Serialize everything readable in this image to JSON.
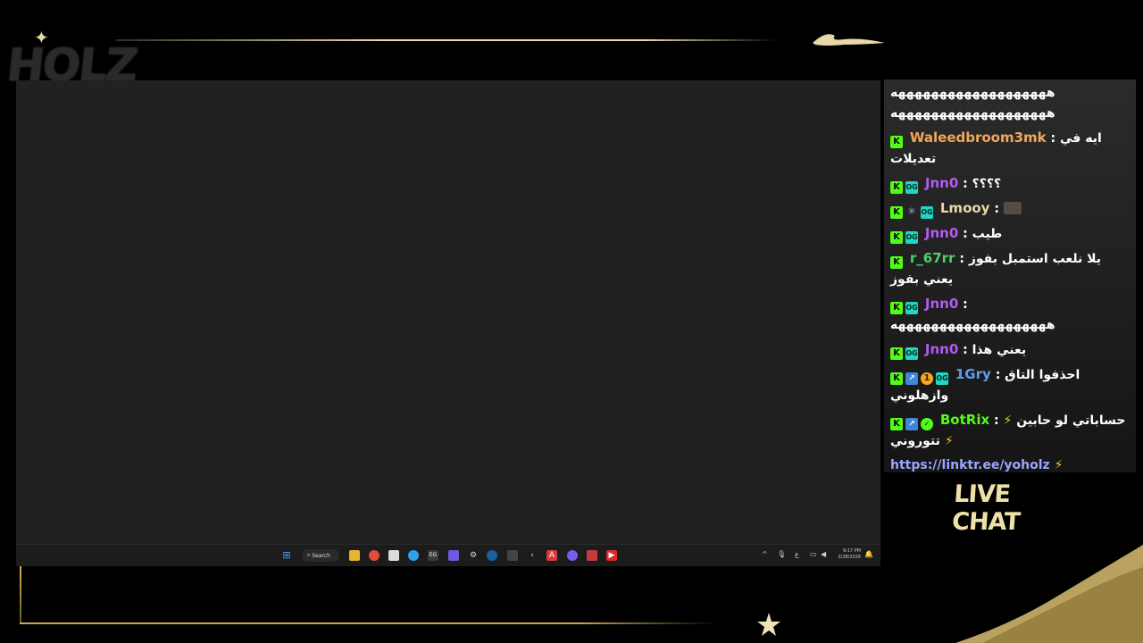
{
  "overlay": {
    "logo_text": "HOLZ",
    "chat_title": "LIVE CHAT"
  },
  "taskbar": {
    "search_label": "Search",
    "clock_time": "9:17 PM",
    "clock_date": "3/28/2026",
    "ime_indicator": "ع"
  },
  "chat": {
    "messages": [
      {
        "username": "",
        "text": "هههههههههههههههههههه\nهههههههههههههههههههه"
      },
      {
        "username": "Waleedbroom3mk",
        "username_color": "#f2a65a",
        "text": "ايه في تعديلات"
      },
      {
        "username": "Jnn0",
        "username_color": "#b05cf0",
        "text": "؟؟؟؟"
      },
      {
        "username": "Lmooy",
        "username_color": "#e9d8a6",
        "text": ""
      },
      {
        "username": "Jnn0",
        "username_color": "#b05cf0",
        "text": "طيب"
      },
      {
        "username": "r_67rr",
        "username_color": "#4fcf68",
        "text": "يلا نلعب استمبل بفوز يعني بفوز"
      },
      {
        "username": "Jnn0",
        "username_color": "#b05cf0",
        "text": "هههههههههههههههههههه"
      },
      {
        "username": "Jnn0",
        "username_color": "#b05cf0",
        "text": "يعني هذا"
      },
      {
        "username": "1Gry",
        "username_color": "#5aa0f0",
        "text": "احذفوا التاق وازهلوني"
      },
      {
        "username": "BotRix",
        "username_color": "#53fc18",
        "text": "حساباتي لو حابين تتوروني"
      },
      {
        "username": "",
        "text": "https://linktr.ee/yoholz"
      }
    ]
  },
  "colors": {
    "gold": "#c9a94f",
    "kick_green": "#53fc18",
    "desktop_bg": "#202222"
  }
}
